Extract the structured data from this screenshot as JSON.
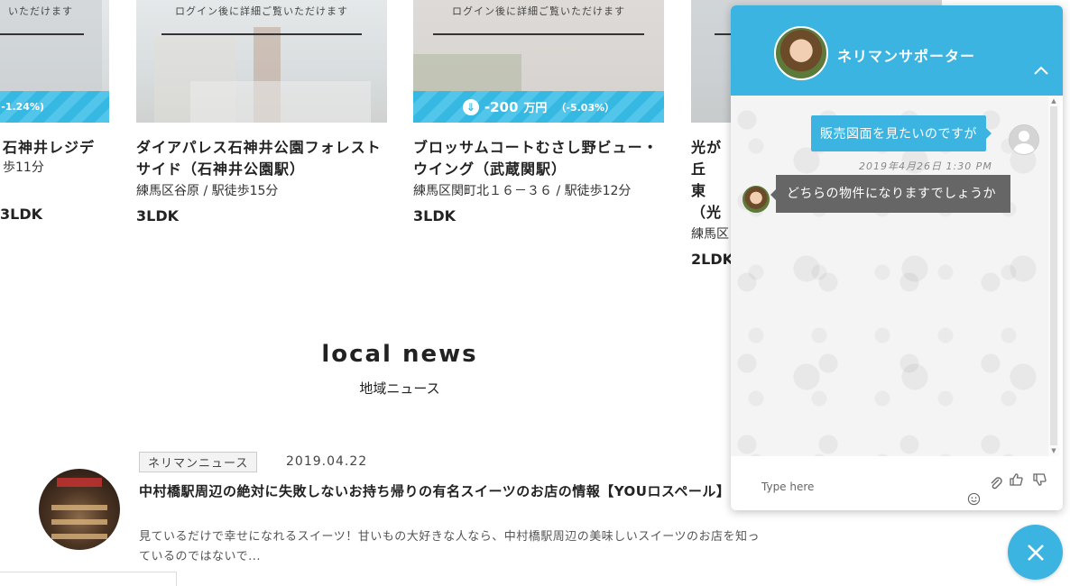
{
  "cards": [
    {
      "login_note": "いただけます",
      "price_pct": "-1.24%)",
      "title": "石神井レジデ",
      "addr": "歩11分",
      "layout": ""
    },
    {
      "login_note": "ログイン後に詳細ご覧いただけます",
      "title": "ダイアパレス石神井公園フォレストサイド（石神井公園駅）",
      "addr": "練馬区谷原 / 駅徒歩15分",
      "layout": "3LDK"
    },
    {
      "login_note": "ログイン後に詳細ご覧いただけます",
      "price_amount": "-200",
      "price_unit": "万円",
      "price_pct": "（-5.03%）",
      "title": "ブロッサムコートむさし野ビュー・ウイング（武蔵関駅）",
      "addr": "練馬区関町北１６－３６ / 駅徒歩12分",
      "layout": "3LDK"
    },
    {
      "title": "光が丘 東（光",
      "addr": "練馬区",
      "layout": "2LDK"
    }
  ],
  "card0_layout": "3LDK",
  "news": {
    "section_title": "local news",
    "section_sub": "地域ニュース",
    "tag": "ネリマンニュース",
    "date": "2019.04.22",
    "title": "中村橋駅周辺の絶対に失敗しないお持ち帰りの有名スイーツのお店の情報【YOUロスペール】",
    "excerpt": "見ているだけで幸せになれるスイーツ！甘いもの大好きな人なら、中村橋駅周辺の美味しいスイーツのお店を知っているのではないで..."
  },
  "chat": {
    "agent_name": "ネリマンサポーター",
    "user_message": "販売図面を見たいのですが",
    "timestamp": "2019年4月26日  1:30 PM",
    "agent_message": "どちらの物件になりますでしょうか",
    "input_placeholder": "Type here"
  },
  "colors": {
    "accent": "#3bb4e1",
    "agent_bubble": "#666666"
  },
  "icons": {
    "collapse": "chevron-up-icon",
    "attach": "paperclip-icon",
    "like": "thumbs-up-icon",
    "dislike": "thumbs-down-icon",
    "emoji": "smiley-icon",
    "close": "close-icon",
    "price_down": "arrow-down-icon"
  }
}
